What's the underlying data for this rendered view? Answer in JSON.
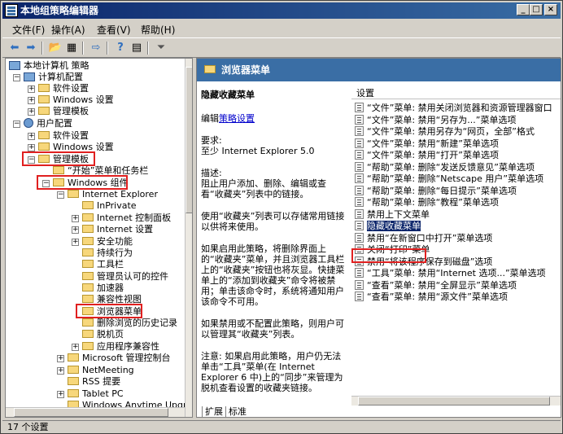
{
  "window": {
    "title": "本地组策略编辑器"
  },
  "menubar": [
    "文件(F)",
    "操作(A)",
    "查看(V)",
    "帮助(H)"
  ],
  "toolbar": [
    "back-icon",
    "forward-icon",
    "up-folder-icon",
    "show-hide-tree-icon",
    "export-icon",
    "help-icon",
    "properties-icon",
    "filter-icon"
  ],
  "tree": [
    {
      "label": "本地计算机 策略"
    },
    {
      "label": "计算机配置"
    },
    {
      "label": "软件设置"
    },
    {
      "label": "Windows 设置"
    },
    {
      "label": "管理模板"
    },
    {
      "label": "用户配置"
    },
    {
      "label": "软件设置"
    },
    {
      "label": "Windows 设置"
    },
    {
      "label": "管理模板"
    },
    {
      "label": "“开始”菜单和任务栏"
    },
    {
      "label": "Windows 组件"
    },
    {
      "label": "Internet Explorer"
    },
    {
      "label": "InPrivate"
    },
    {
      "label": "Internet 控制面板"
    },
    {
      "label": "Internet 设置"
    },
    {
      "label": "安全功能"
    },
    {
      "label": "持续行为"
    },
    {
      "label": "工具栏"
    },
    {
      "label": "管理员认可的控件"
    },
    {
      "label": "加速器"
    },
    {
      "label": "兼容性视图"
    },
    {
      "label": "浏览器菜单"
    },
    {
      "label": "删除浏览的历史记录"
    },
    {
      "label": "脱机页"
    },
    {
      "label": "应用程序兼容性"
    },
    {
      "label": "Microsoft 管理控制台"
    },
    {
      "label": "NetMeeting"
    },
    {
      "label": "RSS 提要"
    },
    {
      "label": "Tablet PC"
    },
    {
      "label": "Windows Anytime Upgrade"
    }
  ],
  "right": {
    "header": "浏览器菜单",
    "desc_title": "隐藏收藏菜单",
    "edit_prefix": "编辑",
    "edit_link": "策略设置",
    "requirement": "要求:\n至少 Internet Explorer 5.0",
    "description": "描述:\n阻止用户添加、删除、编辑或查看“收藏夹”列表中的链接。",
    "p1": "使用“收藏夹”列表可以存储常用链接以供将来使用。",
    "p2": "如果启用此策略，将删除界面上的“收藏夹”菜单，并且浏览器工具栏上的“收藏夹”按钮也将灰显。快捷菜单上的“添加到收藏夹”命令将被禁用；单击该命令时，系统将通知用户该命令不可用。",
    "p3": "如果禁用或不配置此策略，则用户可以管理其“收藏夹”列表。",
    "p4": "注意: 如果启用此策略，用户仍无法单击“工具”菜单(在 Internet Explorer 6 中)上的“同步”来管理为脱机查看设置的收藏夹链接。",
    "settings_header": "设置",
    "settings": [
      "“文件”菜单: 禁用关闭浏览器和资源管理器窗口",
      "“文件”菜单: 禁用“另存为...”菜单选项",
      "“文件”菜单: 禁用另存为“网页，全部”格式",
      "“文件”菜单: 禁用“新建”菜单选项",
      "“文件”菜单: 禁用“打开”菜单选项",
      "“帮助”菜单: 删除“发送反馈意见”菜单选项",
      "“帮助”菜单: 删除“Netscape 用户”菜单选项",
      "“帮助”菜单: 删除“每日提示”菜单选项",
      "“帮助”菜单: 删除“教程”菜单选项",
      "禁用上下文菜单",
      "隐藏收藏菜单",
      "禁用“在新窗口中打开”菜单选项",
      "关闭“打印”菜单",
      "禁用“将该程序保存到磁盘”选项",
      "“工具”菜单: 禁用“Internet 选项...”菜单选项",
      "“查看”菜单: 禁用“全屏显示”菜单选项",
      "“查看”菜单: 禁用“源文件”菜单选项"
    ],
    "tabs": [
      "扩展",
      "标准"
    ]
  },
  "status": "17 个设置"
}
